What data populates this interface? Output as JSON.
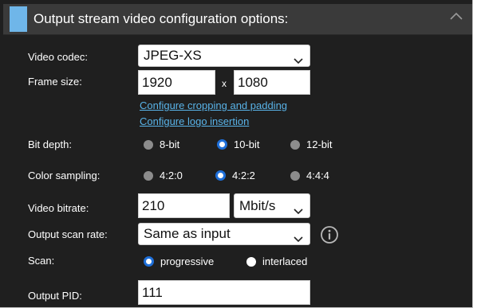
{
  "header": {
    "title": "Output stream video configuration options:"
  },
  "video_codec": {
    "label": "Video codec:",
    "value": "JPEG-XS"
  },
  "frame_size": {
    "label": "Frame size:",
    "width": "1920",
    "separator": "x",
    "height": "1080",
    "link_crop": "Configure cropping and padding",
    "link_logo": "Configure logo insertion"
  },
  "bit_depth": {
    "label": "Bit depth:",
    "options": [
      "8-bit",
      "10-bit",
      "12-bit"
    ],
    "selected": "10-bit"
  },
  "color_sampling": {
    "label": "Color sampling:",
    "options": [
      "4:2:0",
      "4:2:2",
      "4:4:4"
    ],
    "selected": "4:2:2"
  },
  "video_bitrate": {
    "label": "Video bitrate:",
    "value": "210",
    "unit": "Mbit/s"
  },
  "output_scan_rate": {
    "label": "Output scan rate:",
    "value": "Same as input"
  },
  "scan": {
    "label": "Scan:",
    "options": [
      "progressive",
      "interlaced"
    ],
    "selected": "progressive"
  },
  "output_pid": {
    "label": "Output PID:",
    "value": "111"
  },
  "colors": {
    "background": "#1f1f1f",
    "header": "#3a3a3a",
    "accent": "#6fb6e9",
    "link": "#59b3e8",
    "radio_selected": "#1e6fd9"
  }
}
